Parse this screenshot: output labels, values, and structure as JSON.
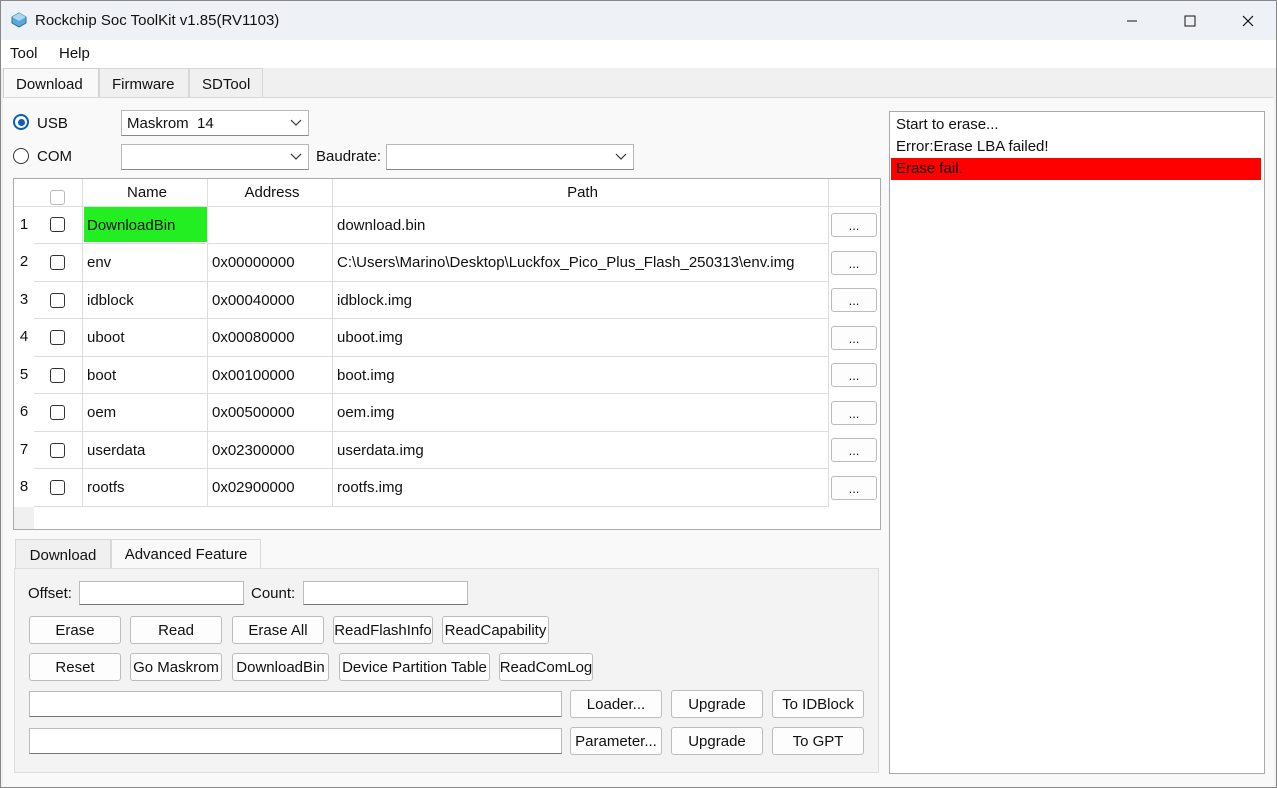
{
  "window": {
    "title": "Rockchip Soc ToolKit v1.85(RV1103)"
  },
  "menu": [
    "Tool",
    "Help"
  ],
  "main_tabs": [
    "Download",
    "Firmware",
    "SDTool"
  ],
  "connection": {
    "usb_label": "USB",
    "usb_selected": true,
    "usb_device": "Maskrom  14",
    "com_label": "COM",
    "com_value": "",
    "baudrate_label": "Baudrate:",
    "baudrate_value": ""
  },
  "grid": {
    "headers": [
      "Name",
      "Address",
      "Path"
    ],
    "rows": [
      {
        "num": "1",
        "name": "DownloadBin",
        "address": "",
        "path": "download.bin",
        "browse": "..."
      },
      {
        "num": "2",
        "name": "env",
        "address": "0x00000000",
        "path": "C:\\Users\\Marino\\Desktop\\Luckfox_Pico_Plus_Flash_250313\\env.img",
        "browse": "..."
      },
      {
        "num": "3",
        "name": "idblock",
        "address": "0x00040000",
        "path": "idblock.img",
        "browse": "..."
      },
      {
        "num": "4",
        "name": "uboot",
        "address": "0x00080000",
        "path": "uboot.img",
        "browse": "..."
      },
      {
        "num": "5",
        "name": "boot",
        "address": "0x00100000",
        "path": "boot.img",
        "browse": "..."
      },
      {
        "num": "6",
        "name": "oem",
        "address": "0x00500000",
        "path": "oem.img",
        "browse": "..."
      },
      {
        "num": "7",
        "name": "userdata",
        "address": "0x02300000",
        "path": "userdata.img",
        "browse": "..."
      },
      {
        "num": "8",
        "name": "rootfs",
        "address": "0x02900000",
        "path": "rootfs.img",
        "browse": "..."
      }
    ],
    "highlight_color": "#22ee22"
  },
  "sub_tabs": [
    "Download",
    "Advanced Feature"
  ],
  "advanced": {
    "offset_label": "Offset:",
    "offset_value": "",
    "count_label": "Count:",
    "count_value": "",
    "row1": [
      "Erase",
      "Read",
      "Erase All",
      "ReadFlashInfo",
      "ReadCapability"
    ],
    "row2": [
      "Reset",
      "Go Maskrom",
      "DownloadBin",
      "Device Partition Table",
      "ReadComLog"
    ],
    "loader_path": "",
    "loader_button": "Loader...",
    "upgrade1_button": "Upgrade",
    "to_idblock_button": "To IDBlock",
    "parameter_path": "",
    "parameter_button": "Parameter...",
    "upgrade2_button": "Upgrade",
    "to_gpt_button": "To GPT"
  },
  "log": {
    "lines": [
      "Start to erase...",
      "Error:Erase LBA failed!",
      "Erase fail."
    ],
    "error_color": "#ff0000"
  }
}
